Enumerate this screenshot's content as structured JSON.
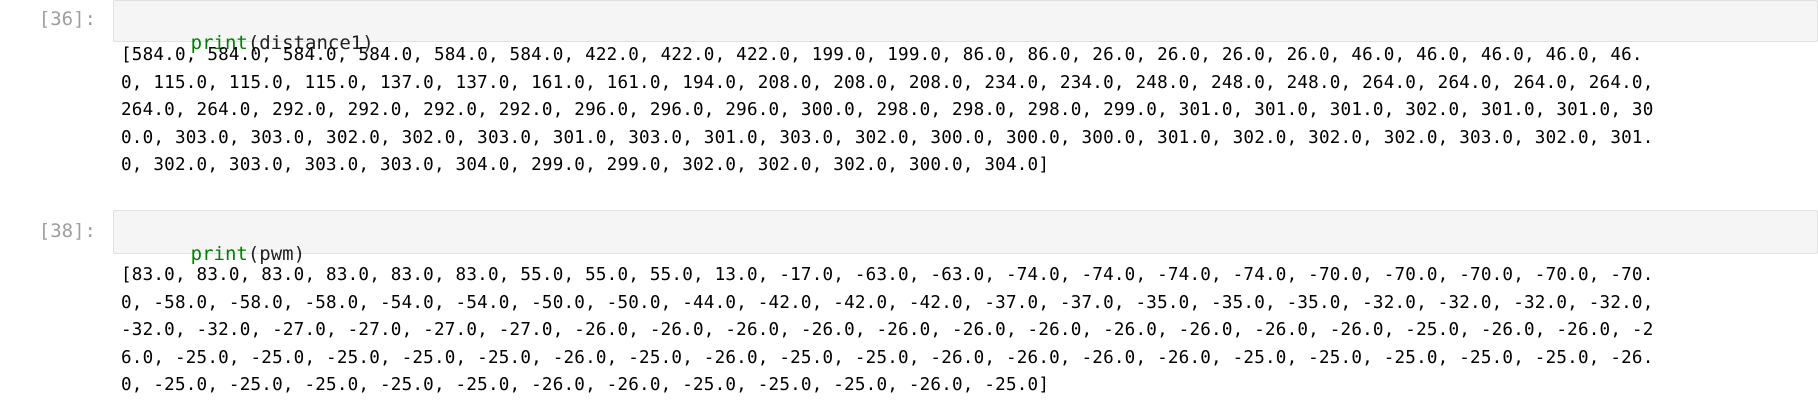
{
  "cells": [
    {
      "prompt": "[36]:",
      "code": {
        "func": "print",
        "open": "(",
        "arg": "distance1",
        "close": ")"
      },
      "output_lines": [
        "[584.0, 584.0, 584.0, 584.0, 584.0, 584.0, 422.0, 422.0, 422.0, 199.0, 199.0, 86.0, 86.0, 26.0, 26.0, 26.0, 26.0, 46.0, 46.0, 46.0, 46.0, 46.",
        "0, 115.0, 115.0, 115.0, 137.0, 137.0, 161.0, 161.0, 194.0, 208.0, 208.0, 208.0, 234.0, 234.0, 248.0, 248.0, 248.0, 264.0, 264.0, 264.0, 264.0,",
        "264.0, 264.0, 292.0, 292.0, 292.0, 292.0, 296.0, 296.0, 296.0, 300.0, 298.0, 298.0, 298.0, 299.0, 301.0, 301.0, 301.0, 302.0, 301.0, 301.0, 30",
        "0.0, 303.0, 303.0, 302.0, 302.0, 303.0, 301.0, 303.0, 301.0, 303.0, 302.0, 300.0, 300.0, 300.0, 301.0, 302.0, 302.0, 302.0, 303.0, 302.0, 301.",
        "0, 302.0, 303.0, 303.0, 303.0, 304.0, 299.0, 299.0, 302.0, 302.0, 302.0, 300.0, 304.0]"
      ]
    },
    {
      "prompt": "[38]:",
      "code": {
        "func": "print",
        "open": "(",
        "arg": "pwm",
        "close": ")"
      },
      "output_lines": [
        "[83.0, 83.0, 83.0, 83.0, 83.0, 83.0, 55.0, 55.0, 55.0, 13.0, -17.0, -63.0, -63.0, -74.0, -74.0, -74.0, -74.0, -70.0, -70.0, -70.0, -70.0, -70.",
        "0, -58.0, -58.0, -58.0, -54.0, -54.0, -50.0, -50.0, -44.0, -42.0, -42.0, -42.0, -37.0, -37.0, -35.0, -35.0, -35.0, -32.0, -32.0, -32.0, -32.0,",
        "-32.0, -32.0, -27.0, -27.0, -27.0, -27.0, -26.0, -26.0, -26.0, -26.0, -26.0, -26.0, -26.0, -26.0, -26.0, -26.0, -26.0, -25.0, -26.0, -26.0, -2",
        "6.0, -25.0, -25.0, -25.0, -25.0, -25.0, -26.0, -25.0, -26.0, -25.0, -25.0, -26.0, -26.0, -26.0, -26.0, -25.0, -25.0, -25.0, -25.0, -25.0, -26.",
        "0, -25.0, -25.0, -25.0, -25.0, -25.0, -26.0, -26.0, -25.0, -25.0, -25.0, -26.0, -25.0]"
      ]
    }
  ]
}
